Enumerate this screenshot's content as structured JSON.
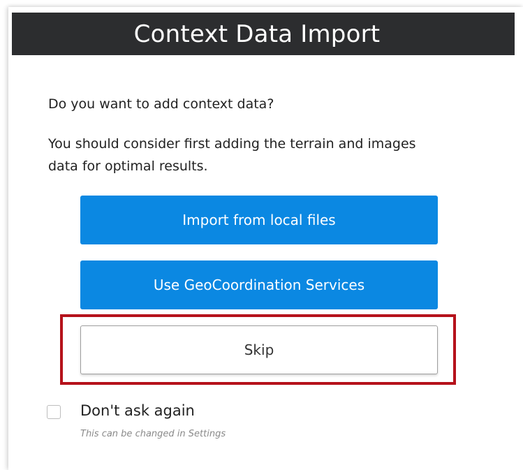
{
  "dialog": {
    "title": "Context Data Import",
    "question": "Do you want to add context data?",
    "advice": "You should consider first adding the terrain and images data for optimal results."
  },
  "buttons": {
    "import_label": "Import from local files",
    "geo_label": "Use GeoCoordination Services",
    "skip_label": "Skip"
  },
  "dont_ask": {
    "label": "Don't ask again",
    "hint": "This can be changed in Settings",
    "checked": false
  },
  "colors": {
    "title_bar": "#2c2d2f",
    "primary_button": "#0b88e2",
    "highlight": "#b5121b"
  }
}
